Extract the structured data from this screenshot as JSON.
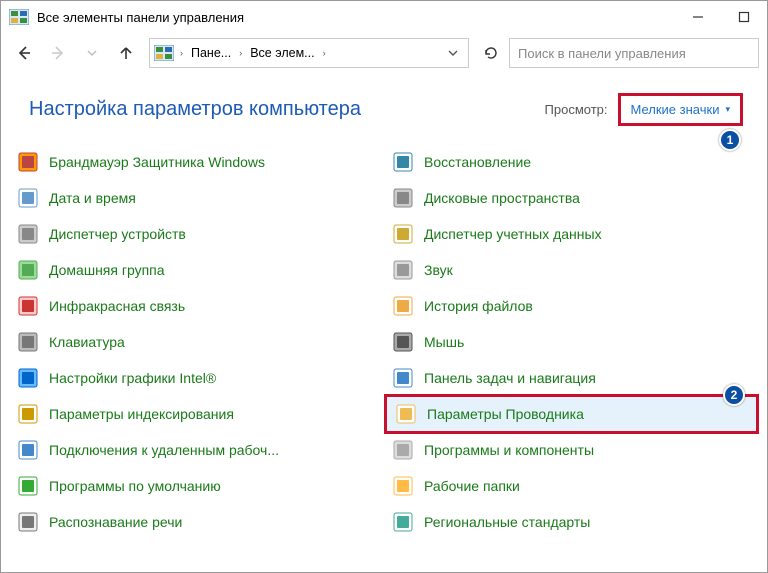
{
  "titlebar": {
    "title": "Все элементы панели управления"
  },
  "nav": {
    "breadcrumb": [
      {
        "label": "Пане..."
      },
      {
        "label": "Все элем..."
      }
    ],
    "search_placeholder": "Поиск в панели управления"
  },
  "header": {
    "page_title": "Настройка параметров компьютера",
    "view_label": "Просмотр:",
    "view_value": "Мелкие значки"
  },
  "badges": {
    "b1": "1",
    "b2": "2"
  },
  "items_left": [
    {
      "icon": "firewall-icon",
      "label": "Брандмауэр Защитника Windows"
    },
    {
      "icon": "datetime-icon",
      "label": "Дата и время"
    },
    {
      "icon": "device-manager-icon",
      "label": "Диспетчер устройств"
    },
    {
      "icon": "homegroup-icon",
      "label": "Домашняя группа"
    },
    {
      "icon": "infrared-icon",
      "label": "Инфракрасная связь"
    },
    {
      "icon": "keyboard-icon",
      "label": "Клавиатура"
    },
    {
      "icon": "intel-graphics-icon",
      "label": "Настройки графики Intel®"
    },
    {
      "icon": "indexing-icon",
      "label": "Параметры индексирования"
    },
    {
      "icon": "remote-app-icon",
      "label": "Подключения к удаленным рабоч..."
    },
    {
      "icon": "default-programs-icon",
      "label": "Программы по умолчанию"
    },
    {
      "icon": "speech-icon",
      "label": "Распознавание речи"
    }
  ],
  "items_right": [
    {
      "icon": "recovery-icon",
      "label": "Восстановление"
    },
    {
      "icon": "storage-spaces-icon",
      "label": "Дисковые пространства"
    },
    {
      "icon": "credential-manager-icon",
      "label": "Диспетчер учетных данных"
    },
    {
      "icon": "sound-icon",
      "label": "Звук"
    },
    {
      "icon": "file-history-icon",
      "label": "История файлов"
    },
    {
      "icon": "mouse-icon",
      "label": "Мышь"
    },
    {
      "icon": "taskbar-icon",
      "label": "Панель задач и навигация"
    },
    {
      "icon": "explorer-options-icon",
      "label": "Параметры Проводника",
      "highlighted": true
    },
    {
      "icon": "programs-features-icon",
      "label": "Программы и компоненты"
    },
    {
      "icon": "work-folders-icon",
      "label": "Рабочие папки"
    },
    {
      "icon": "region-icon",
      "label": "Региональные стандарты"
    }
  ]
}
